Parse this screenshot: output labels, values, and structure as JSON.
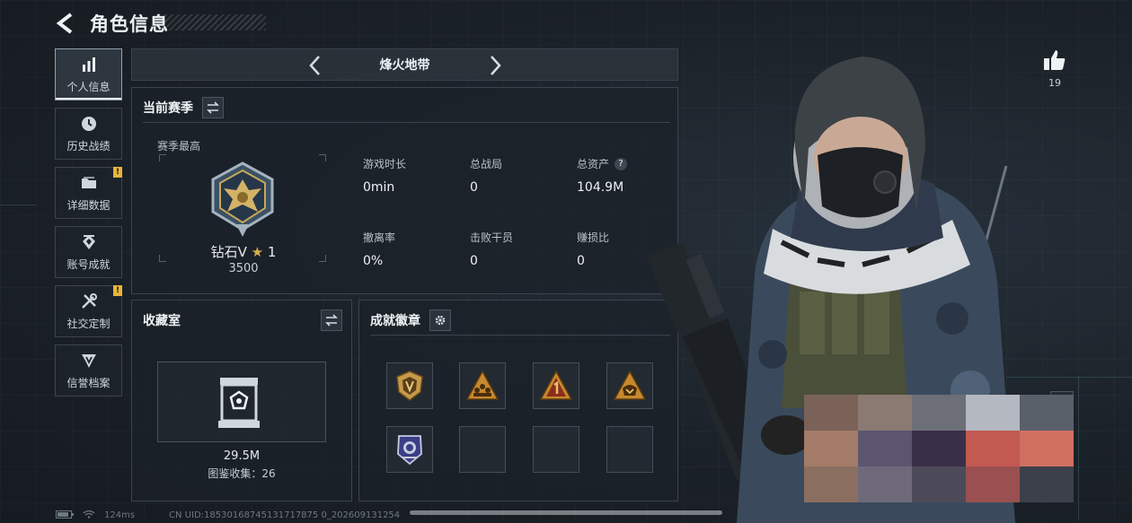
{
  "header": {
    "title": "角色信息"
  },
  "sidebar": {
    "items": [
      {
        "label": "个人信息",
        "icon": "bar-chart-icon",
        "active": true,
        "badge": ""
      },
      {
        "label": "历史战绩",
        "icon": "clock-icon",
        "active": false,
        "badge": ""
      },
      {
        "label": "详细数据",
        "icon": "folder-icon",
        "active": false,
        "badge": "!"
      },
      {
        "label": "账号成就",
        "icon": "emblem-icon",
        "active": false,
        "badge": ""
      },
      {
        "label": "社交定制",
        "icon": "tools-icon",
        "active": false,
        "badge": "!"
      },
      {
        "label": "信誉档案",
        "icon": "shield-icon",
        "active": false,
        "badge": ""
      }
    ]
  },
  "mode": {
    "label": "烽火地带"
  },
  "season": {
    "title": "当前赛季",
    "best_label": "赛季最高",
    "rank_name": "钻石V",
    "rank_star": "★",
    "rank_stars": "1",
    "rank_score": "3500",
    "stats": [
      {
        "label": "游戏时长",
        "value": "0min",
        "help": false
      },
      {
        "label": "总战局",
        "value": "0",
        "help": false
      },
      {
        "label": "总资产",
        "value": "104.9M",
        "help": true
      },
      {
        "label": "撤离率",
        "value": "0%",
        "help": false
      },
      {
        "label": "击败干员",
        "value": "0",
        "help": false
      },
      {
        "label": "赚损比",
        "value": "0",
        "help": false
      }
    ],
    "help_glyph": "?"
  },
  "collection": {
    "title": "收藏室",
    "value": "29.5M",
    "count_text": "图鉴收集：26"
  },
  "achievements": {
    "title": "成就徽章",
    "badges": [
      "shield-badge-icon",
      "triangle-team-badge-icon",
      "triangle-number-one-badge-icon",
      "triangle-shield-badge-icon",
      "police-badge-icon",
      "",
      "",
      ""
    ]
  },
  "likes": {
    "count": "19"
  },
  "footer": {
    "ping": "124ms",
    "uid": "CN UID:18530168745131717875 0_202609131254"
  },
  "colors": {
    "accent": "#e8b43c",
    "panel_border": "#3a444e",
    "background": "#1a2027"
  }
}
